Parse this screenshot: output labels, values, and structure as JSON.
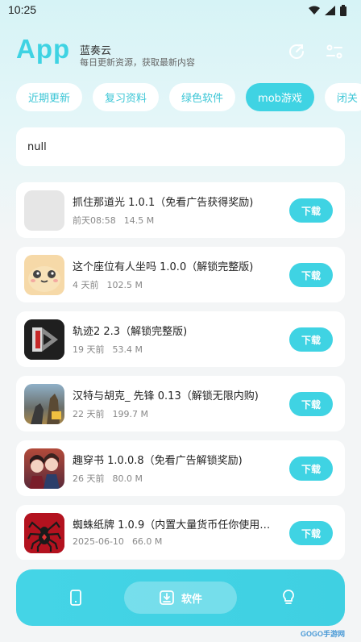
{
  "status_bar": {
    "time": "10:25"
  },
  "header": {
    "logo": "App",
    "name": "蓝奏云",
    "subtitle": "每日更新资源，获取最新内容"
  },
  "tabs": [
    {
      "label": "近期更新",
      "active": false
    },
    {
      "label": "复习资料",
      "active": false
    },
    {
      "label": "绿色软件",
      "active": false
    },
    {
      "label": "mob游戏",
      "active": true
    },
    {
      "label": "闭关",
      "active": false
    }
  ],
  "search": {
    "value": "null"
  },
  "apps": [
    {
      "title": "抓住那道光 1.0.1（免看广告获得奖励)",
      "date": "前天08:58",
      "size": "14.5 M",
      "button": "下载",
      "icon": "placeholder-icon"
    },
    {
      "title": "这个座位有人坐吗 1.0.0（解锁完整版)",
      "date": "4 天前",
      "size": "102.5 M",
      "button": "下载",
      "icon": "cute-face-icon"
    },
    {
      "title": "轨迹2 2.3（解锁完整版)",
      "date": "19 天前",
      "size": "53.4 M",
      "button": "下载",
      "icon": "trajectory-logo-icon"
    },
    {
      "title": "汉特与胡克_ 先锋 0.13（解锁无限内购)",
      "date": "22 天前",
      "size": "199.7 M",
      "button": "下载",
      "icon": "game-art-icon"
    },
    {
      "title": "趣穿书 1.0.0.8（免看广告解锁奖励)",
      "date": "26 天前",
      "size": "80.0 M",
      "button": "下载",
      "icon": "anime-characters-icon"
    },
    {
      "title": "蜘蛛纸牌 1.0.9（内置大量货币任你使用…",
      "date": "2025-06-10",
      "size": "66.0 M",
      "button": "下载",
      "icon": "spider-icon"
    }
  ],
  "bottom_nav": {
    "active_label": "软件"
  },
  "watermark": "GOGO手游网",
  "colors": {
    "accent": "#3fd3e3",
    "tab_text": "#3cc6d6",
    "background": "#f3f5f6"
  }
}
